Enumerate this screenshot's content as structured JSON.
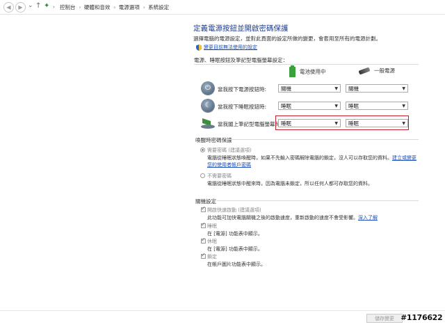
{
  "address_bar": {
    "breadcrumbs": [
      "控制台",
      "硬體和音效",
      "電源選項",
      "系統設定"
    ]
  },
  "page": {
    "title": "定義電源按鈕並開啟密碼保護",
    "subtitle": "選擇電腦的電源設定，並對此頁面的設定所做的變更，會套用至所有的電源計劃。",
    "change_settings_link": "變更目前無法使用的設定"
  },
  "power_buttons": {
    "section_title": "電源、睡眠按鈕及筆記型電腦螢幕設定：",
    "col_battery": "電池使用中",
    "col_plugged": "一般電源",
    "rows": [
      {
        "label": "當我按下電源按鈕時:",
        "battery": "關機",
        "plugged": "關機"
      },
      {
        "label": "當我按下睡眠按鈕時:",
        "battery": "睡眠",
        "plugged": "睡眠"
      },
      {
        "label": "當我闔上筆記型電腦螢幕時:",
        "battery": "睡眠",
        "plugged": "睡眠"
      }
    ]
  },
  "wake_password": {
    "section_title": "喚醒時密碼保護",
    "require": {
      "label": "需要密碼 (建議選項)",
      "desc1": "電腦從睡眠狀態喚醒時，如果不先輸入密碼解除電腦的鎖定，沒人可以存取您的資料。",
      "link_part1": "建立或變更",
      "link_part2": "您的使用者帳戶密碼"
    },
    "no_require": {
      "label": "不需要密碼",
      "desc": "電腦從睡眠狀態中醒來時，因為電腦未鎖定，所以任何人都可存取您的資料。"
    }
  },
  "shutdown": {
    "section_title": "關機設定",
    "items": [
      {
        "label": "開啟快速啟動 (建議選項)",
        "desc": "此功能可加快電腦關機之後的啟動速度，重新啟動的速度不會受影響。",
        "link": "深入了解"
      },
      {
        "label": "睡眠",
        "desc": "在 [電源] 功能表中顯示。"
      },
      {
        "label": "休眠",
        "desc": "在 [電源] 功能表中顯示。"
      },
      {
        "label": "鎖定",
        "desc": "在帳戶圖片功能表中顯示。"
      }
    ]
  },
  "footer": {
    "save_label": "儲存變更"
  },
  "watermark": "#1176622",
  "colors": {
    "title_blue": "#1e3d8f",
    "link_blue": "#1a4fb8",
    "highlight_red": "#c0202a",
    "battery_green": "#3aa03a"
  }
}
